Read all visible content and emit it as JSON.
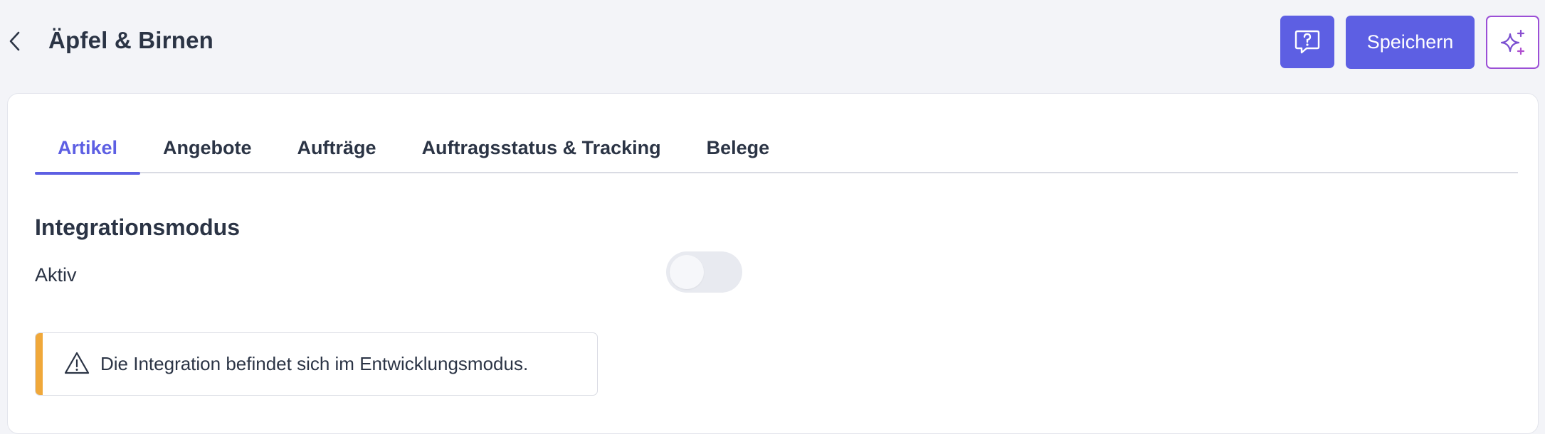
{
  "header": {
    "title": "Äpfel & Birnen",
    "save_label": "Speichern"
  },
  "tabs": [
    {
      "label": "Artikel",
      "active": true
    },
    {
      "label": "Angebote",
      "active": false
    },
    {
      "label": "Aufträge",
      "active": false
    },
    {
      "label": "Auftragsstatus & Tracking",
      "active": false
    },
    {
      "label": "Belege",
      "active": false
    }
  ],
  "section": {
    "title": "Integrationsmodus",
    "active_label": "Aktiv",
    "toggle_on": false
  },
  "alert": {
    "type": "warning",
    "text": "Die Integration befindet sich im Entwicklungsmodus."
  },
  "colors": {
    "accent": "#5d5fe3",
    "warning": "#f0a83a",
    "ai_border": "#9b4fd6"
  },
  "icons": {
    "back": "chevron-left-icon",
    "help": "help-chat-icon",
    "ai": "sparkles-icon",
    "alert": "warning-triangle-icon"
  }
}
